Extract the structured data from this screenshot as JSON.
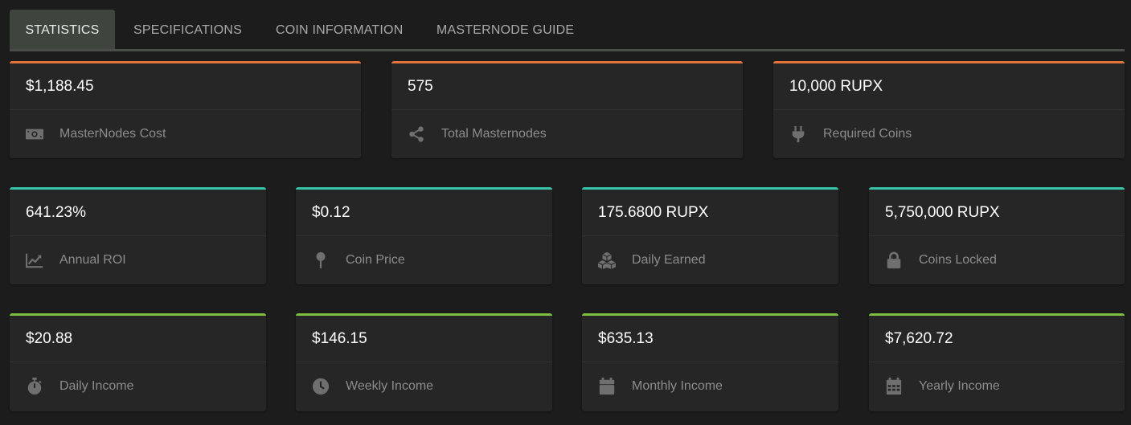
{
  "tabs": [
    {
      "label": "STATISTICS",
      "active": true
    },
    {
      "label": "SPECIFICATIONS",
      "active": false
    },
    {
      "label": "COIN INFORMATION",
      "active": false
    },
    {
      "label": "MASTERNODE GUIDE",
      "active": false
    }
  ],
  "colors": {
    "orange": "#e0743c",
    "teal": "#36c3aa",
    "green": "#7fbf3f"
  },
  "stats": {
    "masternodes_cost": {
      "value": "$1,188.45",
      "label": "MasterNodes Cost",
      "icon": "money-icon"
    },
    "total_masternodes": {
      "value": "575",
      "label": "Total Masternodes",
      "icon": "share-icon"
    },
    "required_coins": {
      "value": "10,000 RUPX",
      "label": "Required Coins",
      "icon": "plug-icon"
    },
    "annual_roi": {
      "value": "641.23%",
      "label": "Annual ROI",
      "icon": "line-chart-icon"
    },
    "coin_price": {
      "value": "$0.12",
      "label": "Coin Price",
      "icon": "pin-icon"
    },
    "daily_earned": {
      "value": "175.6800 RUPX",
      "label": "Daily Earned",
      "icon": "cubes-icon"
    },
    "coins_locked": {
      "value": "5,750,000 RUPX",
      "label": "Coins Locked",
      "icon": "lock-icon"
    },
    "daily_income": {
      "value": "$20.88",
      "label": "Daily Income",
      "icon": "stopwatch-icon"
    },
    "weekly_income": {
      "value": "$146.15",
      "label": "Weekly Income",
      "icon": "clock-icon"
    },
    "monthly_income": {
      "value": "$635.13",
      "label": "Monthly Income",
      "icon": "calendar-icon"
    },
    "yearly_income": {
      "value": "$7,620.72",
      "label": "Yearly Income",
      "icon": "calendar-grid-icon"
    }
  }
}
